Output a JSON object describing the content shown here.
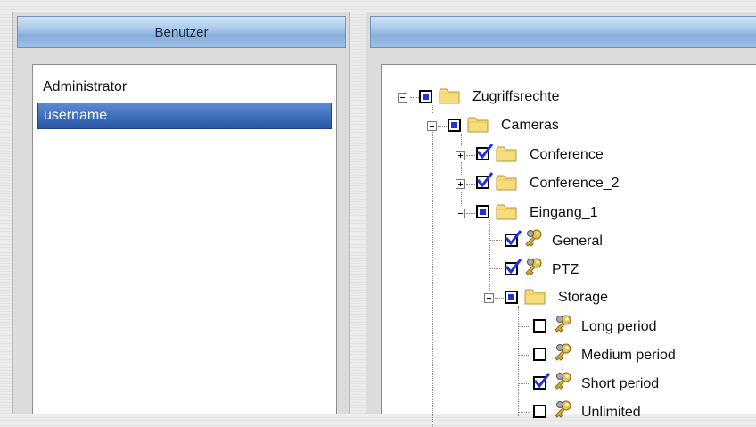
{
  "users_panel": {
    "header": "Benutzer",
    "users": [
      {
        "name": "Administrator",
        "selected": false
      },
      {
        "name": "username",
        "selected": true
      }
    ]
  },
  "rights_panel": {
    "header": "",
    "tree": {
      "root": {
        "label": "Zugriffsrechte",
        "state": "partial",
        "expanded": true
      },
      "cameras": {
        "label": "Cameras",
        "state": "partial",
        "expanded": true
      },
      "conference": {
        "label": "Conference",
        "state": "checked",
        "expanded": false
      },
      "conference_2": {
        "label": "Conference_2",
        "state": "checked",
        "expanded": false
      },
      "eingang_1": {
        "label": "Eingang_1",
        "state": "partial",
        "expanded": true
      },
      "general": {
        "label": "General",
        "state": "checked"
      },
      "ptz": {
        "label": "PTZ",
        "state": "checked"
      },
      "storage": {
        "label": "Storage",
        "state": "partial",
        "expanded": true
      },
      "long_period": {
        "label": "Long period",
        "state": "unchecked"
      },
      "medium_period": {
        "label": "Medium period",
        "state": "unchecked"
      },
      "short_period": {
        "label": "Short period",
        "state": "checked"
      },
      "unlimited": {
        "label": "Unlimited",
        "state": "unchecked"
      }
    }
  },
  "colors": {
    "header_blue": "#9dc0e6",
    "selection_blue": "#2757a6",
    "check_blue": "#2130e0",
    "folder_yellow": "#f7dc7c"
  }
}
